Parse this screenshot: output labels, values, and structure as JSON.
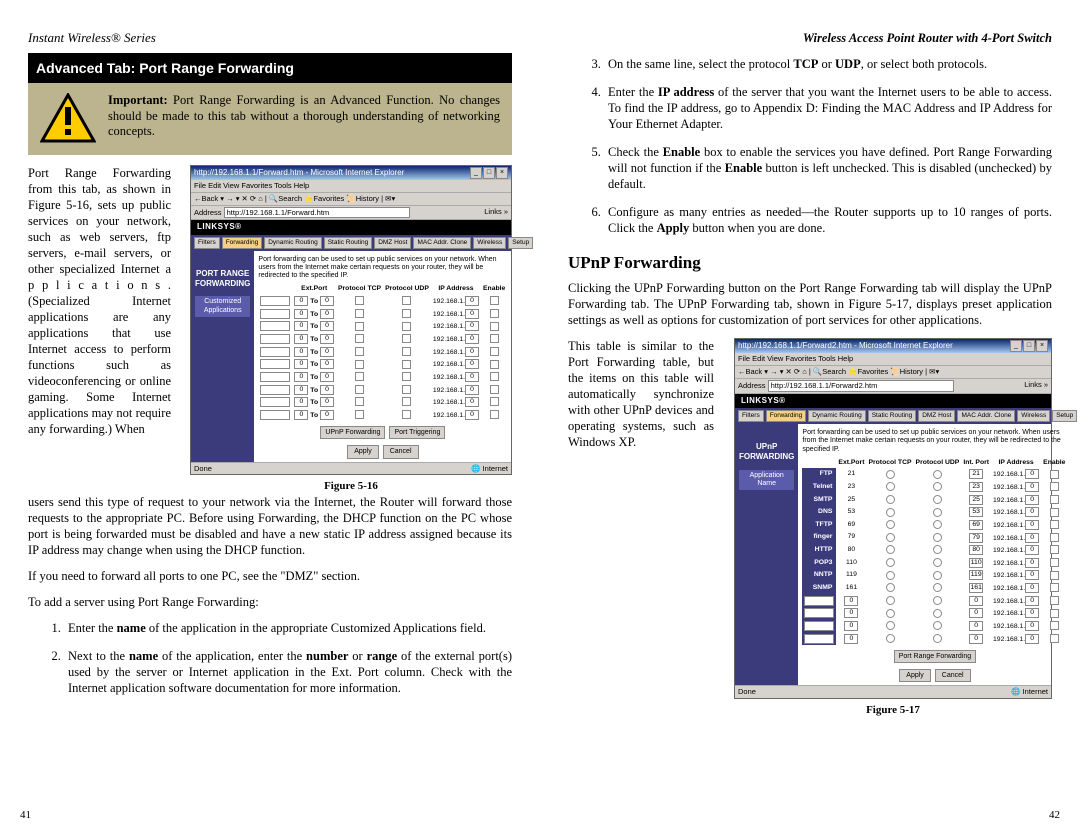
{
  "left": {
    "running_head": "Instant Wireless® Series",
    "blackbar": "Advanced Tab: Port Range Forwarding",
    "khaki_important": "Important:",
    "khaki_text": " Port Range Forwarding is an Advanced Function. No changes should be made to this tab without a thorough understanding of networking concepts.",
    "float_text": "Port Range Forwarding from this tab, as shown in Figure 5-16, sets up public services on your network, such as web servers, ftp servers, e-mail servers, or other specialized Internet a p p l i c a t i o n s . (Specialized Internet applications are any applications that use Internet access to perform functions such as videoconferencing or online gaming. Some Internet applications may not require any forwarding.) When",
    "after_float": "users send this type of request to your network via the Internet, the Router will forward those requests to the appropriate PC. Before using Forwarding, the DHCP function on the PC whose port is being forwarded must be disabled and have a new static IP address assigned because its IP address may change when using the DHCP function.",
    "dmz_para": "If you need to forward all ports to one PC, see the \"DMZ\" section.",
    "addserver_para": "To add a server using Port Range Forwarding:",
    "steps": [
      "Enter the name of the application in the appropriate Customized Applications field.",
      "Next to the name of the application, enter the number or range of the external port(s) used by the server or Internet application in the Ext. Port column. Check with the Internet application software documentation for more information."
    ],
    "fig_caption": "Figure 5-16",
    "pagenum": "41"
  },
  "right": {
    "running_head": "Wireless Access Point Router with 4-Port Switch",
    "steps": [
      "On the same line, select the protocol TCP or UDP, or select both protocols.",
      "Enter the IP address of the server that you want the Internet users to be able to access. To find the IP address, go to Appendix D: Finding the MAC Address and IP Address for Your Ethernet Adapter.",
      "Check the Enable box to enable the services you have defined. Port Range Forwarding will not function if the Enable button is left unchecked. This is disabled (unchecked) by default.",
      "Configure as many entries as needed—the Router supports up to 10 ranges of ports. Click the Apply button when you are done."
    ],
    "h2": "UPnP Forwarding",
    "upnp_para": "Clicking the UPnP Forwarding button on the Port Range Forwarding tab will display the UPnP Forwarding tab. The UPnP Forwarding tab, shown in Figure 5-17, displays preset application settings as well as options for customization of port services for other applications.",
    "float_text": "This table is similar to the Port Forwarding table, but the items on this table will automatically synchronize with other UPnP devices and operating systems, such as Windows XP.",
    "fig_caption": "Figure 5-17",
    "pagenum": "42"
  },
  "fig16": {
    "ie_title": "http://192.168.1.1/Forward.htm - Microsoft Internet Explorer",
    "menu": "File  Edit  View  Favorites  Tools  Help",
    "toolbar": "←Back ▾ → ▾ ✕ ⟳ ⌂ | 🔍Search ⭐Favorites 📜History | ✉▾",
    "addr_label": "Address",
    "addr": "http://192.168.1.1/Forward.htm",
    "brand": "LINKSYS®",
    "side_title": "PORT RANGE\nFORWARDING",
    "side_sub": "Customized Applications",
    "tabs": [
      "Filters",
      "Forwarding",
      "Dynamic Routing",
      "Static Routing",
      "DMZ Host",
      "MAC Addr. Clone",
      "Wireless",
      "Setup"
    ],
    "desc": "Port forwarding can be used to set up public services on your network. When users from the Internet make certain requests on your router, they will be redirected to the specified IP.",
    "headers": [
      "Ext.Port",
      "Protocol TCP",
      "Protocol UDP",
      "IP Address",
      "Enable"
    ],
    "ip_prefix": "192.168.1.",
    "to_label": "To",
    "default_port": "0",
    "row_count": 10,
    "sublinks": [
      "UPnP Forwarding",
      "Port Triggering"
    ],
    "buttons": [
      "Apply",
      "Cancel"
    ],
    "status_left": "Done",
    "status_right": "🌐 Internet"
  },
  "fig17": {
    "ie_title": "http://192.168.1.1/Forward2.htm - Microsoft Internet Explorer",
    "menu": "File  Edit  View  Favorites  Tools  Help",
    "toolbar": "←Back ▾ → ▾ ✕ ⟳ ⌂ | 🔍Search ⭐Favorites 📜History | ✉▾",
    "addr_label": "Address",
    "addr": "http://192.168.1.1/Forward2.htm",
    "brand": "LINKSYS®",
    "side_title": "UPnP\nFORWARDING",
    "side_sub": "Application Name",
    "tabs": [
      "Filters",
      "Forwarding",
      "Dynamic Routing",
      "Static Routing",
      "DMZ Host",
      "MAC Addr. Clone",
      "Wireless",
      "Setup"
    ],
    "desc": "Port forwarding can be used to set up public services on your network. When users from the Internet make certain requests on your router, they will be redirected to the specified IP.",
    "headers": [
      "Ext.Port",
      "Protocol TCP",
      "Protocol UDP",
      "Int. Port",
      "IP Address",
      "Enable"
    ],
    "ip_prefix": "192.168.1.",
    "rows": [
      {
        "name": "FTP",
        "ext": "21",
        "int": "21"
      },
      {
        "name": "Telnet",
        "ext": "23",
        "int": "23"
      },
      {
        "name": "SMTP",
        "ext": "25",
        "int": "25"
      },
      {
        "name": "DNS",
        "ext": "53",
        "int": "53"
      },
      {
        "name": "TFTP",
        "ext": "69",
        "int": "69"
      },
      {
        "name": "finger",
        "ext": "79",
        "int": "79"
      },
      {
        "name": "HTTP",
        "ext": "80",
        "int": "80"
      },
      {
        "name": "POP3",
        "ext": "110",
        "int": "110"
      },
      {
        "name": "NNTP",
        "ext": "119",
        "int": "119"
      },
      {
        "name": "SNMP",
        "ext": "161",
        "int": "161"
      }
    ],
    "blank_rows": 4,
    "default_port": "0",
    "sublinks": [
      "Port Range Forwarding"
    ],
    "buttons": [
      "Apply",
      "Cancel"
    ],
    "status_left": "Done",
    "status_right": "🌐 Internet"
  }
}
